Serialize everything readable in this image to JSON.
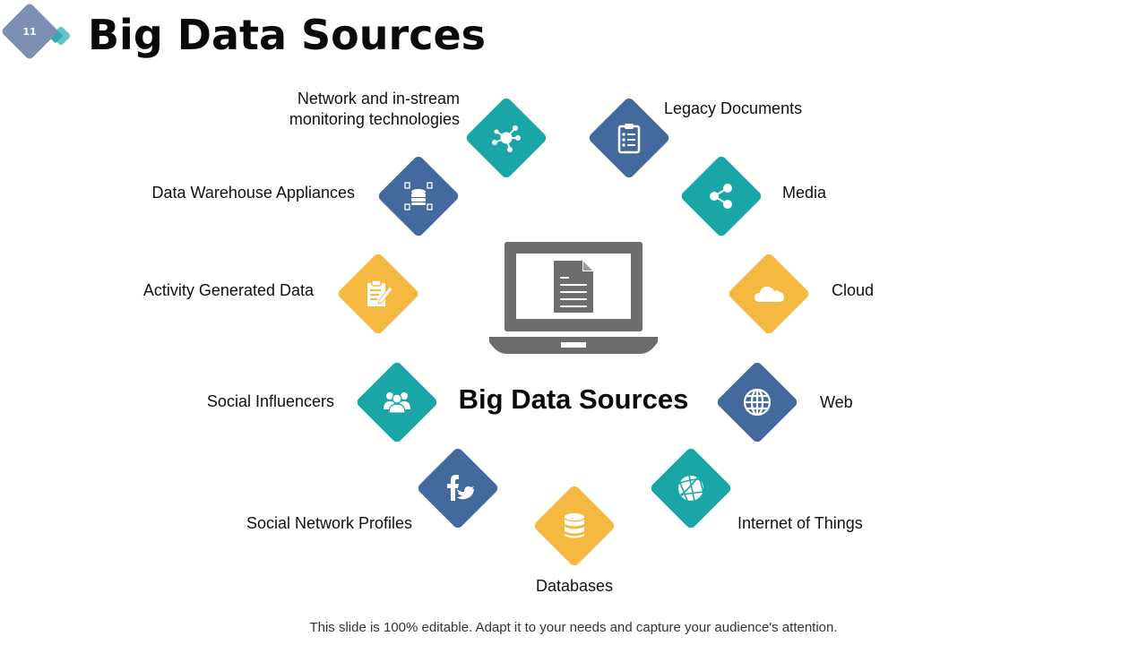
{
  "slide": {
    "number": "11",
    "title": "Big Data Sources",
    "center_title": "Big Data Sources",
    "footer": "This slide is 100% editable. Adapt it to your needs and capture your audience's attention."
  },
  "colors": {
    "teal": "#1aa6a6",
    "navy": "#44699c",
    "yellow": "#f5b942",
    "laptop_gray": "#6d6d6d",
    "badge": "#7d8fb3",
    "badge_accent": "#5bc4c4"
  },
  "sources": [
    {
      "label_line1": "Network and in-stream",
      "label_line2": "monitoring technologies",
      "icon": "network-hub-icon",
      "color": "teal"
    },
    {
      "label": "Legacy Documents",
      "icon": "clipboard-list-icon",
      "color": "navy"
    },
    {
      "label": "Data Warehouse Appliances",
      "icon": "database-servers-icon",
      "color": "navy"
    },
    {
      "label": "Media",
      "icon": "share-icon",
      "color": "teal"
    },
    {
      "label": "Activity Generated Data",
      "icon": "clipboard-edit-icon",
      "color": "yellow"
    },
    {
      "label": "Cloud",
      "icon": "cloud-icon",
      "color": "yellow"
    },
    {
      "label": "Social Influencers",
      "icon": "users-group-icon",
      "color": "teal"
    },
    {
      "label": "Web",
      "icon": "globe-icon",
      "color": "navy"
    },
    {
      "label": "Social Network Profiles",
      "icon": "facebook-twitter-icon",
      "color": "navy"
    },
    {
      "label": "Internet of Things",
      "icon": "iot-globe-icon",
      "color": "teal"
    },
    {
      "label": "Databases",
      "icon": "database-icon",
      "color": "yellow"
    }
  ]
}
